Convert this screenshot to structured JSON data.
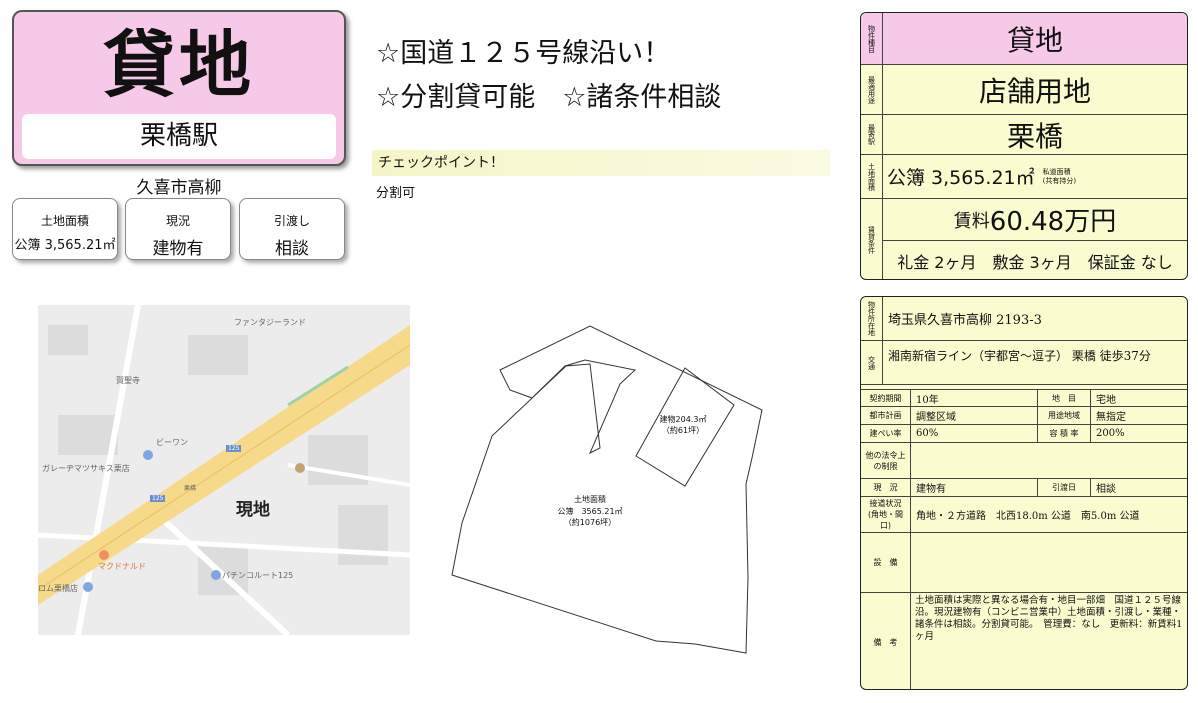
{
  "title": {
    "main": "貸地",
    "station": "栗橋駅"
  },
  "area_label": "久喜市高柳",
  "summary": [
    {
      "label": "土地面積",
      "value": "公簿 3,565.21㎡"
    },
    {
      "label": "現況",
      "value": "建物有"
    },
    {
      "label": "引渡し",
      "value": "相談"
    }
  ],
  "headline": {
    "line1": "☆国道１２５号線沿い！",
    "line2": "☆分割貸可能　☆諸条件相談"
  },
  "checkpoint": {
    "title": "チェックポイント！",
    "body": "分割可"
  },
  "map": {
    "genchi": "現地",
    "labels": [
      "ファンタジーランド",
      "賀聖寺",
      "ビーワン",
      "ガレーヂマツサキス栗店",
      "125",
      "125",
      "マクドナルド",
      "パチンコルート125",
      "ロム栗橋店",
      "栗橋"
    ]
  },
  "plan": {
    "building": "建物204.3㎡\n（約61坪）",
    "land_title": "土地面積",
    "land_value": "公簿　3565.21㎡",
    "land_tsubo": "（約1076坪）"
  },
  "panel1": {
    "type_label": "物件種目",
    "type_value": "貸地",
    "use_label": "最適用途",
    "use_value": "店舗用地",
    "station_label": "最寄駅",
    "station_value": "栗橋",
    "area_label": "土地面積",
    "area_value": "公簿 3,565.21㎡",
    "private_road": "私道面積\n(共有持分)",
    "rent_label": "賃貸条件",
    "rent_prefix": "賃料 ",
    "rent_value": "60.48万円",
    "terms": "礼金 2ヶ月　敷金 3ヶ月　保証金 なし"
  },
  "panel2": {
    "address_label": "物件所在地",
    "address": "埼玉県久喜市高柳 2193-3",
    "transport_label": "交通",
    "transport": "湘南新宿ライン（宇都宮～逗子） 栗橋 徒歩37分",
    "contract_label": "契約期間",
    "contract": "10年",
    "chimoku_label": "地　目",
    "chimoku": "宅地",
    "toshi_label": "都市計画",
    "toshi": "調整区域",
    "youto_label": "用途地域",
    "youto": "無指定",
    "kenpei_label": "建ぺい率",
    "kenpei": "60%",
    "youseki_label": "容 積 率",
    "youseki": "200%",
    "hourei_label": "他の法令上の制限",
    "hourei": "",
    "genkyou_label": "現　況",
    "genkyou": "建物有",
    "hikiwatashi_label": "引渡日",
    "hikiwatashi": "相談",
    "setsudou_label": "接道状況(角地・間口)",
    "setsudou": "角地・２方道路　北西18.0m 公道　南5.0m 公道",
    "setsubi_label": "設　備",
    "setsubi": "",
    "bikou_label": "備　考",
    "bikou": "土地面積は実際と異なる場合有・地目一部畑　国道１２５号線沿。現況建物有（コンビニ営業中）土地面積・引渡し・業種・諸条件は相談。分割貸可能。　管理費：なし　更新料：新賃料1ヶ月"
  },
  "colors": {
    "title_bg": "#f7c9e8",
    "panel_bg": "#fbfbd0",
    "check_bg": "#f5f5c8",
    "road": "#f7d98a"
  }
}
